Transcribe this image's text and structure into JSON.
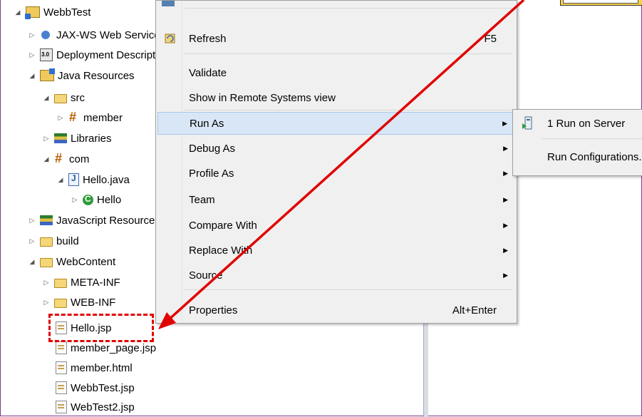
{
  "explorer": {
    "items": [
      {
        "label": "WebbTest",
        "icon": "web-project-icon",
        "twisty": "expanded"
      },
      {
        "label": "JAX-WS Web Services",
        "icon": "web-services-icon",
        "twisty": "collapsed"
      },
      {
        "label": "Deployment Descriptor",
        "icon": "deployment-descriptor-icon",
        "twisty": "collapsed"
      },
      {
        "label": "Java Resources",
        "icon": "java-resources-icon",
        "twisty": "expanded"
      },
      {
        "label": "src",
        "icon": "source-folder-icon",
        "twisty": "expanded"
      },
      {
        "label": "member",
        "icon": "package-icon",
        "twisty": "collapsed"
      },
      {
        "label": "Libraries",
        "icon": "libraries-icon",
        "twisty": "collapsed"
      },
      {
        "label": "com",
        "icon": "package-icon",
        "twisty": "expanded"
      },
      {
        "label": "Hello.java",
        "icon": "java-file-icon",
        "twisty": "expanded"
      },
      {
        "label": "Hello",
        "icon": "class-icon",
        "twisty": "collapsed"
      },
      {
        "label": "JavaScript Resources",
        "icon": "libraries-icon",
        "twisty": "collapsed"
      },
      {
        "label": "build",
        "icon": "folder-icon",
        "twisty": "collapsed"
      },
      {
        "label": "WebContent",
        "icon": "folder-icon",
        "twisty": "expanded"
      },
      {
        "label": "META-INF",
        "icon": "folder-icon",
        "twisty": "collapsed"
      },
      {
        "label": "WEB-INF",
        "icon": "folder-icon",
        "twisty": "collapsed"
      },
      {
        "label": "Hello.jsp",
        "icon": "jsp-file-icon",
        "twisty": "none"
      },
      {
        "label": "member_page.jsp",
        "icon": "jsp-file-icon",
        "twisty": "none"
      },
      {
        "label": "member.html",
        "icon": "jsp-file-icon",
        "twisty": "none"
      },
      {
        "label": "WebbTest.jsp",
        "icon": "jsp-file-icon",
        "twisty": "none"
      },
      {
        "label": "WebTest2.jsp",
        "icon": "jsp-file-icon",
        "twisty": "none"
      }
    ]
  },
  "context_menu": {
    "items": [
      {
        "label": "Refresh",
        "accelerator": "F5",
        "submenu": false,
        "highlighted": false
      },
      {
        "label": "Validate",
        "accelerator": "",
        "submenu": false,
        "highlighted": false
      },
      {
        "label": "Show in Remote Systems view",
        "accelerator": "",
        "submenu": false,
        "highlighted": false
      },
      {
        "label": "Run As",
        "accelerator": "",
        "submenu": true,
        "highlighted": true
      },
      {
        "label": "Debug As",
        "accelerator": "",
        "submenu": true,
        "highlighted": false
      },
      {
        "label": "Profile As",
        "accelerator": "",
        "submenu": true,
        "highlighted": false
      },
      {
        "label": "Team",
        "accelerator": "",
        "submenu": true,
        "highlighted": false
      },
      {
        "label": "Compare With",
        "accelerator": "",
        "submenu": true,
        "highlighted": false
      },
      {
        "label": "Replace With",
        "accelerator": "",
        "submenu": true,
        "highlighted": false
      },
      {
        "label": "Source",
        "accelerator": "",
        "submenu": true,
        "highlighted": false
      },
      {
        "label": "Properties",
        "accelerator": "Alt+Enter",
        "submenu": false,
        "highlighted": false
      }
    ]
  },
  "run_as_submenu": {
    "items": [
      {
        "label": "1 Run on Server"
      },
      {
        "label": "Run Configurations..."
      }
    ]
  },
  "colors": {
    "highlight_fill": "#d9e6f5",
    "annotation_red": "#e00000",
    "menu_bg": "#f0f0f0"
  }
}
